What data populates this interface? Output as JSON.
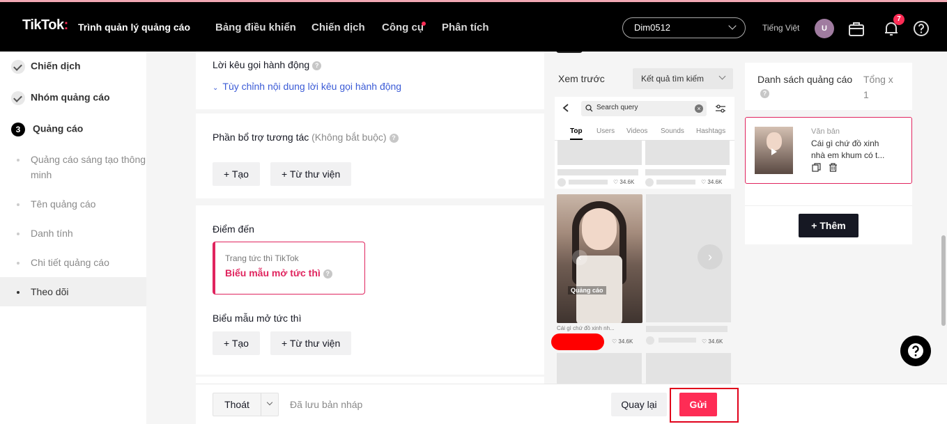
{
  "header": {
    "brand": "TikTok",
    "brand_colon": ":",
    "subtitle": "Trình quản lý quảng cáo",
    "nav": [
      "Bảng điều khiển",
      "Chiến dịch",
      "Công cụ",
      "Phân tích"
    ],
    "account": "Dim0512",
    "language": "Tiếng Việt",
    "avatar_letter": "U",
    "notification_count": "7"
  },
  "sidebar": {
    "steps": [
      "Chiến dịch",
      "Nhóm quảng cáo"
    ],
    "current_step_number": "3",
    "current_step": "Quảng cáo",
    "substeps": [
      "Quảng cáo sáng tạo thông minh",
      "Tên quảng cáo",
      "Danh tính",
      "Chi tiết quảng cáo",
      "Theo dõi"
    ]
  },
  "form": {
    "cta_label": "Lời kêu gọi hành động",
    "cta_link": "Tùy chỉnh nội dung lời kêu gọi hành động",
    "interactive_label": "Phần bổ trợ tương tác",
    "interactive_optional": "(Không bắt buộc)",
    "create_label": "Tạo",
    "library_label": "Từ thư viện",
    "destination_label": "Điểm đến",
    "destination_small": "Trang tức thì TikTok",
    "destination_big": "Biểu mẫu mở tức thì",
    "instant_form_label": "Biểu mẫu mở tức thì"
  },
  "preview": {
    "label": "Xem trước",
    "placement": "Kết quả tìm kiếm",
    "search_placeholder": "Search query",
    "tabs": [
      "Top",
      "Users",
      "Videos",
      "Sounds",
      "Hashtags"
    ],
    "likes": "34.6K",
    "ad_tag": "Quảng cáo",
    "caption": "Cái gì chứ đồ xinh nh..."
  },
  "ad_list": {
    "title": "Danh sách quảng cáo",
    "total": "Tổng x",
    "count": "1",
    "item_type": "Văn bản",
    "item_text_1": "Cái gì chứ đồ xinh",
    "item_text_2": "nhà em khum có t...",
    "add_label": "Thêm"
  },
  "footer": {
    "exit_label": "Thoát",
    "draft_status": "Đã lưu bản nháp",
    "back_label": "Quay lại",
    "submit_label": "Gửi"
  },
  "colors": {
    "accent": "#fe2c55",
    "destination": "#e0245e",
    "link": "#3b5bd6",
    "header_bg": "#000000",
    "highlight_border": "#e0001a"
  }
}
